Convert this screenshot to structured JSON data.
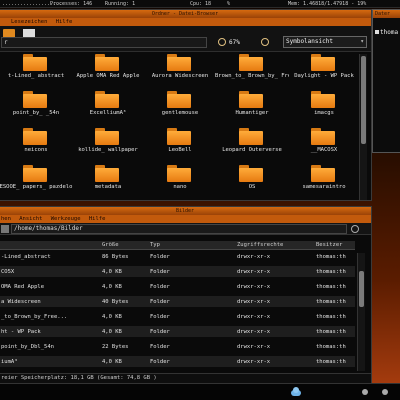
{
  "top_panel": {
    "processes": "Processes: 146",
    "running": "Running: 1",
    "cpu": "Cpu: 18",
    "percent": "%",
    "mem": "Mem: 1.46818/1.47918 - 19%"
  },
  "upper_window": {
    "title": "Ordner - Datei-Browser",
    "menu": [
      "Lesezeichen",
      "Hilfe"
    ],
    "location": "r",
    "zoom_label": "67%",
    "view_mode": "Symbolansicht",
    "items": [
      "t-Lined_ abstract",
      "Apple OMA Red Apple",
      "Aurora Widescreen",
      "Brown_to_ Brown_by_ Freeman",
      "Daylight - WP Pack",
      "point_by_ _54n",
      "ExcelliumÃ³",
      "gentlemouse",
      "Humantiger",
      "imacgs",
      "neicons",
      "kollide_ wallpaper",
      "LeoBell",
      "Leopard Outerverse",
      "__MACOSX",
      "ESOOE_ papers_ pazdelo",
      "metadata",
      "nano",
      "OS",
      "samesaraintro"
    ]
  },
  "lower_window": {
    "title": "Bilder",
    "menu": [
      "hen",
      "Ansicht",
      "Werkzeuge",
      "Hilfe"
    ],
    "path": "/home/thomas/Bilder",
    "columns": [
      "",
      "Größe",
      "Typ",
      "Zugriffsrechte",
      "Besitzer"
    ],
    "rows": [
      [
        "-Lined_abstract",
        "86 Bytes",
        "Folder",
        "drwxr-xr-x",
        "thomas:th"
      ],
      [
        "CO5X",
        "4,0 KB",
        "Folder",
        "drwxr-xr-x",
        "thomas:th"
      ],
      [
        "OMA Red Apple",
        "4,0 KB",
        "Folder",
        "drwxr-xr-x",
        "thomas:th"
      ],
      [
        "a Widescreen",
        "40 Bytes",
        "Folder",
        "drwxr-xr-x",
        "thomas:th"
      ],
      [
        "_to_Brown_by_Free...",
        "4,0 KB",
        "Folder",
        "drwxr-xr-x",
        "thomas:th"
      ],
      [
        "ht - WP Pack",
        "4,0 KB",
        "Folder",
        "drwxr-xr-x",
        "thomas:th"
      ],
      [
        "point_by_Dbl_54n",
        "22 Bytes",
        "Folder",
        "drwxr-xr-x",
        "thomas:th"
      ],
      [
        "iumÃ³",
        "4,0 KB",
        "Folder",
        "drwxr-xr-x",
        "thomas:th"
      ]
    ],
    "status": "reier Speicherplatz: 18,1 GB (Gesamt: 74,8 GB )"
  },
  "right_window": {
    "title": "Dater",
    "item": "thoma"
  }
}
